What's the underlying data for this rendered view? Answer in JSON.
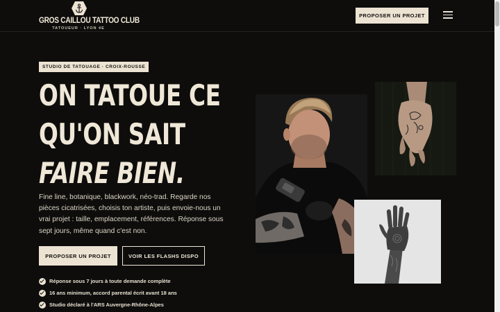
{
  "brand": {
    "name": "GROS CAILLOU TATTOO CLUB",
    "tagline": "TATOUEUR · LYON 4E",
    "badge_icon": "anchor-icon"
  },
  "header": {
    "cta_label": "PROPOSER UN PROJET",
    "menu_icon": "hamburger-menu-icon"
  },
  "hero": {
    "tag": "STUDIO DE TATOUAGE · CROIX-ROUSSE",
    "headline_line1": "ON TATOUE CE",
    "headline_line2": "QU'ON SAIT",
    "headline_line3": "FAIRE BIEN.",
    "intro": "Fine line, botanique, blackwork, néo-trad. Regarde nos pièces cicatrisées, choisis ton artiste, puis envoie-nous un vrai projet : taille, emplacement, références. Réponse sous sept jours, même quand c'est non.",
    "primary_cta": "PROPOSER UN PROJET",
    "secondary_cta": "VOIR LES FLASHS DISPO",
    "checks": [
      "Réponse sous 7 jours à toute demande complète",
      "16 ans minimum, accord parental écrit avant 18 ans",
      "Studio déclaré à l'ARS Auvergne-Rhône-Alpes"
    ]
  },
  "colors": {
    "background": "#0e0d0c",
    "cream": "#ece3d2",
    "text": "#efe7d7"
  }
}
